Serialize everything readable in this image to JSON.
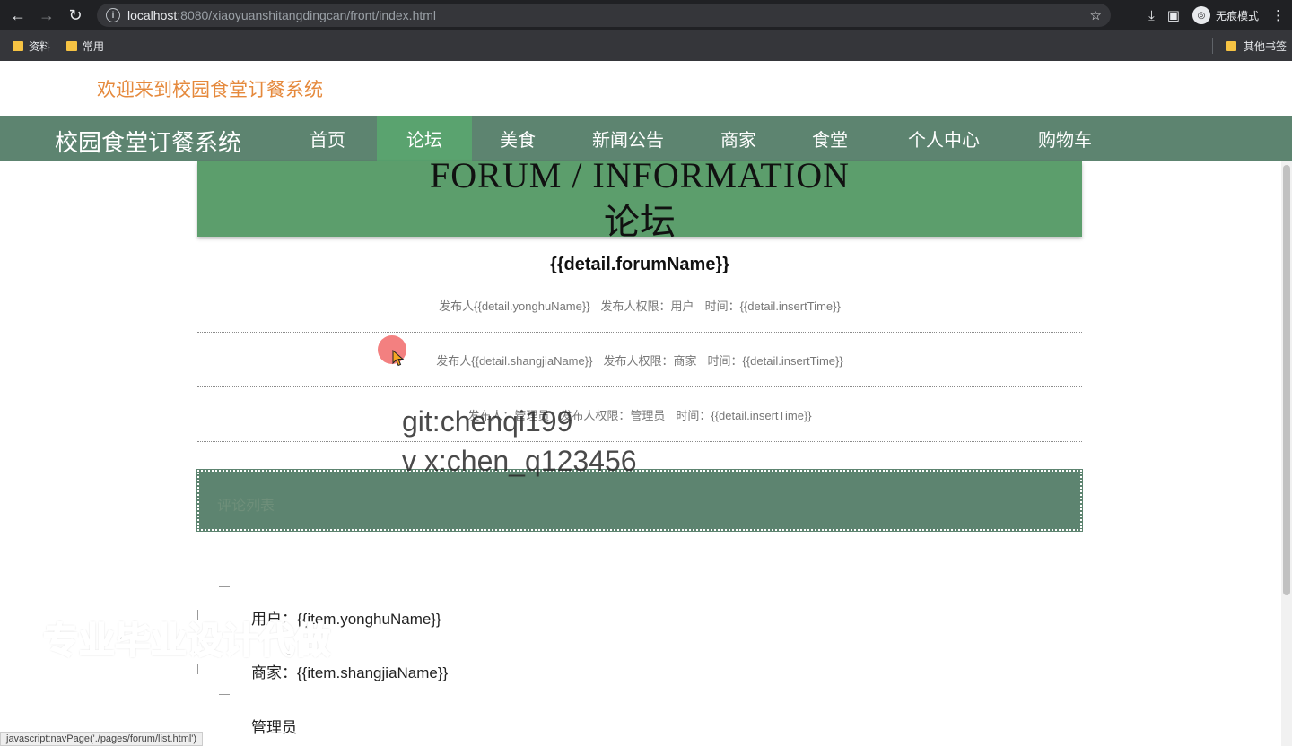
{
  "browser": {
    "url_host": "localhost",
    "url_path": ":8080/xiaoyuanshitangdingcan/front/index.html",
    "incognito_label": "无痕模式",
    "bookmarks": [
      "资料",
      "常用"
    ],
    "other_bookmarks": "其他书签",
    "status_text": "javascript:navPage('./pages/forum/list.html')"
  },
  "header": {
    "welcome": "欢迎来到校园食堂订餐系统",
    "brand": "校园食堂订餐系统",
    "nav": [
      "首页",
      "论坛",
      "美食",
      "新闻公告",
      "商家",
      "食堂",
      "个人中心",
      "购物车"
    ],
    "active_nav": "论坛"
  },
  "hero": {
    "en_title": "FORUM / INFORMATION",
    "cn_title": "论坛"
  },
  "detail": {
    "title": "{{detail.forumName}}",
    "rows": [
      [
        "发布人{{detail.yonghuName}}",
        "发布人权限：用户",
        "时间：{{detail.insertTime}}"
      ],
      [
        "发布人{{detail.shangjiaName}}",
        "发布人权限：商家",
        "时间：{{detail.insertTime}}"
      ],
      [
        "发布人：管理员",
        "发布人权限：管理员",
        "时间：{{detail.insertTime}}"
      ]
    ]
  },
  "comments": {
    "panel_title": "评论列表",
    "items": [
      "用户：{{item.yonghuName}}",
      "商家：{{item.shangjiaName}}",
      "管理员"
    ]
  },
  "watermarks": [
    "git:chenqi199",
    "v x:chen_q123456",
    "专业毕业设计代做"
  ],
  "colors": {
    "navbar": "#5d8470",
    "active_nav": "#5aa36f",
    "hero": "#5c9e6c",
    "welcome": "#e5893c"
  }
}
